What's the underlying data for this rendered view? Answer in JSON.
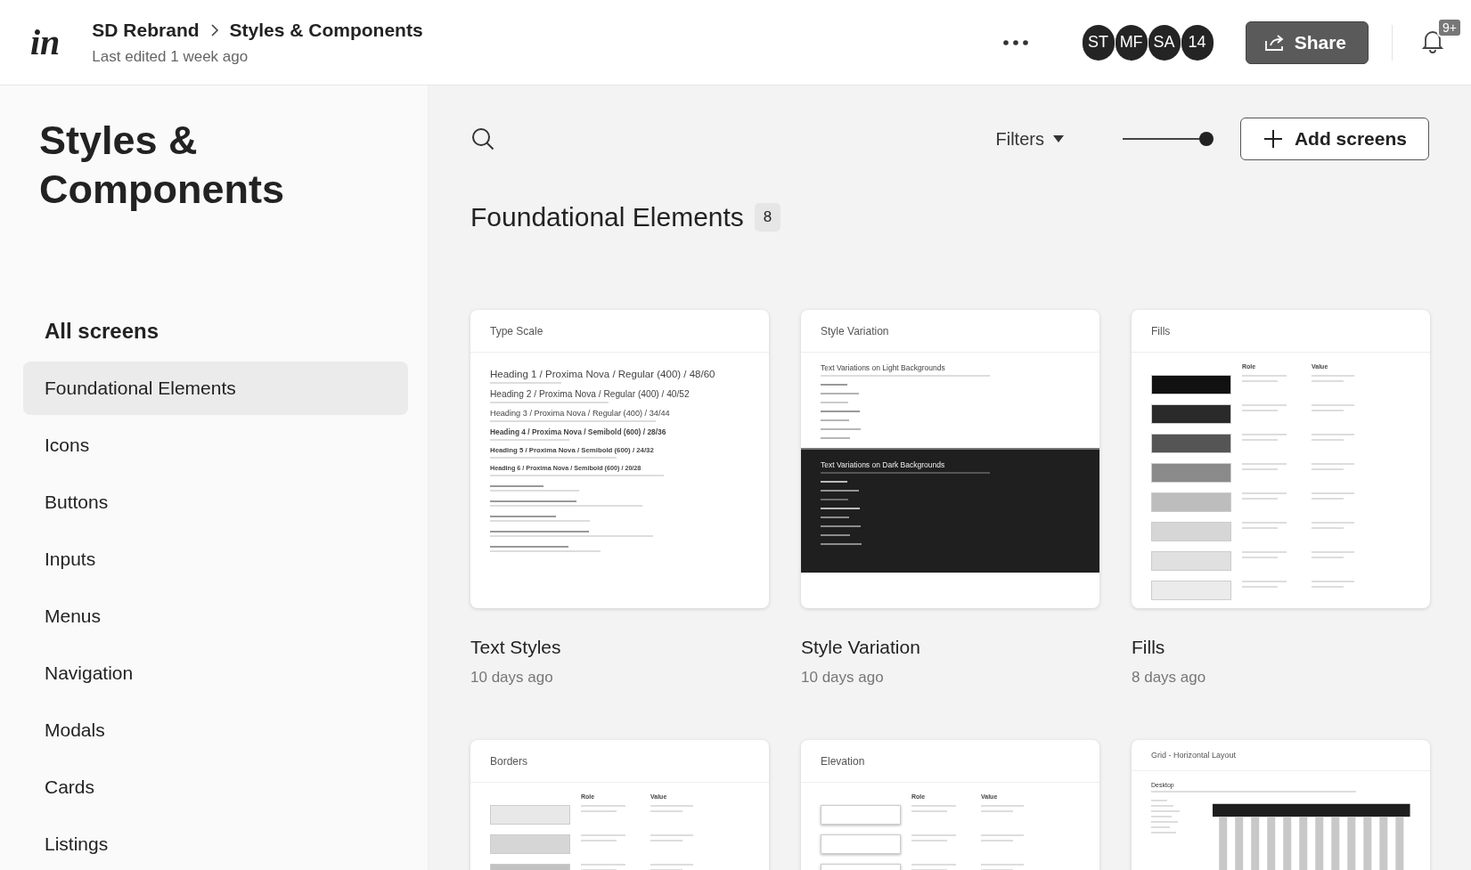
{
  "header": {
    "logo": "in",
    "project": "SD Rebrand",
    "page": "Styles & Components",
    "last_edited": "Last edited 1 week ago",
    "avatars": [
      {
        "initials": "ST"
      },
      {
        "initials": "MF"
      },
      {
        "initials": "SA"
      }
    ],
    "more_count": "14",
    "share": "Share",
    "notifications": "9+"
  },
  "sidebar": {
    "title": "Styles & Components",
    "all_screens": "All screens",
    "items": [
      {
        "label": "Foundational Elements",
        "selected": true
      },
      {
        "label": "Icons",
        "selected": false
      },
      {
        "label": "Buttons",
        "selected": false
      },
      {
        "label": "Inputs",
        "selected": false
      },
      {
        "label": "Menus",
        "selected": false
      },
      {
        "label": "Navigation",
        "selected": false
      },
      {
        "label": "Modals",
        "selected": false
      },
      {
        "label": "Cards",
        "selected": false
      },
      {
        "label": "Listings",
        "selected": false
      }
    ]
  },
  "toolbar": {
    "filters": "Filters",
    "zoom": {
      "level": 1
    },
    "add_screens": "Add screens"
  },
  "section": {
    "title": "Foundational Elements",
    "count": "8"
  },
  "cards": [
    {
      "name": "Text Styles",
      "updated": "10 days ago",
      "preview": {
        "kind": "type-scale",
        "title": "Type Scale",
        "lines": [
          {
            "text": "Heading 1 / Proxima Nova / Regular (400) / 48/60",
            "kind": "h1"
          },
          {
            "text": "Heading 2 / Proxima Nova / Regular (400) / 40/52",
            "kind": "h2"
          },
          {
            "text": "Heading 3 / Proxima Nova / Regular (400) / 34/44",
            "kind": "h3"
          },
          {
            "text": "Heading 4 / Proxima Nova / Semibold (600) / 28/36",
            "kind": "h4"
          },
          {
            "text": "Heading 5 / Proxima Nova / Semibold (600) / 24/32",
            "kind": "h5"
          },
          {
            "text": "Heading 6 / Proxima Nova / Semibold (600) / 20/28",
            "kind": "h6"
          }
        ]
      }
    },
    {
      "name": "Style Variation",
      "updated": "10 days ago",
      "preview": {
        "kind": "variations",
        "title": "Style Variation",
        "sections": [
          {
            "dark": false,
            "heading": "Text Variations on Light Backgrounds"
          },
          {
            "dark": true,
            "heading": "Text Variations on Dark Backgrounds"
          }
        ]
      }
    },
    {
      "name": "Fills",
      "updated": "8 days ago",
      "preview": {
        "kind": "swatches",
        "title": "Fills",
        "columns": [
          "Role",
          "Value"
        ],
        "rows": [
          {
            "color": "#111111"
          },
          {
            "color": "#2a2a2a"
          },
          {
            "color": "#555555"
          },
          {
            "color": "#8a8a8a"
          },
          {
            "color": "#bdbdbd"
          },
          {
            "color": "#d6d6d6"
          },
          {
            "color": "#e0e0e0"
          },
          {
            "color": "#ebebeb"
          }
        ]
      }
    },
    {
      "preview": {
        "kind": "swatches",
        "title": "Borders",
        "columns": [
          "Role",
          "Value"
        ],
        "rows": [
          {
            "color": "#e8e8e8"
          },
          {
            "color": "#d6d6d6"
          },
          {
            "color": "#c2c2c2"
          }
        ]
      }
    },
    {
      "preview": {
        "kind": "swatches",
        "title": "Elevation",
        "columns": [
          "Role",
          "Value"
        ],
        "rows": [
          {
            "color": "#ffffff"
          },
          {
            "color": "#ffffff"
          },
          {
            "color": "#ffffff"
          }
        ]
      }
    },
    {
      "preview": {
        "kind": "grid",
        "title": "Grid - Horizontal Layout",
        "heading": "Desktop"
      }
    }
  ]
}
